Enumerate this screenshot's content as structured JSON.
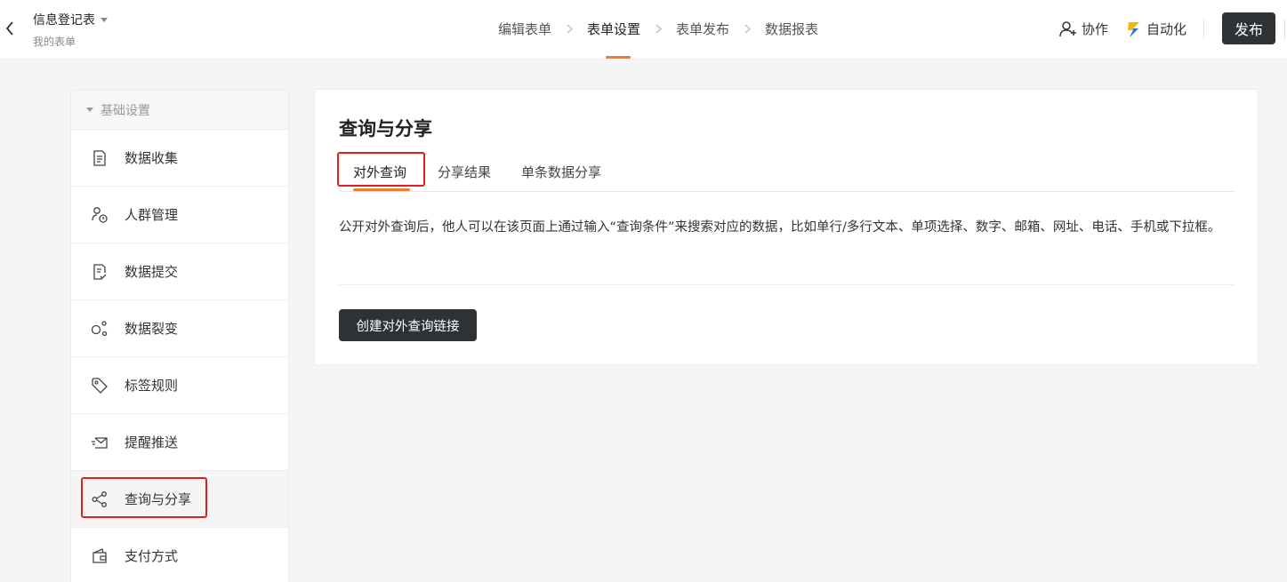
{
  "header": {
    "form_title": "信息登记表",
    "form_subtitle": "我的表单",
    "steps": [
      "编辑表单",
      "表单设置",
      "表单发布",
      "数据报表"
    ],
    "active_step": "表单设置",
    "collab_label": "协作",
    "automation_label": "自动化",
    "publish_label": "发布",
    "accent_color": "#f07d2c"
  },
  "sidebar": {
    "section_label": "基础设置",
    "items": [
      {
        "label": "数据收集",
        "icon": "document-list-icon"
      },
      {
        "label": "人群管理",
        "icon": "user-clock-icon"
      },
      {
        "label": "数据提交",
        "icon": "document-check-icon"
      },
      {
        "label": "数据裂变",
        "icon": "nodes-icon"
      },
      {
        "label": "标签规则",
        "icon": "tag-icon"
      },
      {
        "label": "提醒推送",
        "icon": "envelope-send-icon"
      },
      {
        "label": "查询与分享",
        "icon": "share-icon"
      },
      {
        "label": "支付方式",
        "icon": "wallet-icon"
      }
    ],
    "active_item": "查询与分享"
  },
  "main": {
    "title": "查询与分享",
    "tabs": [
      "对外查询",
      "分享结果",
      "单条数据分享"
    ],
    "active_tab": "对外查询",
    "description": "公开对外查询后，他人可以在该页面上通过输入“查询条件”来搜索对应的数据，比如单行/多行文本、单项选择、数字、邮箱、网址、电话、手机或下拉框。",
    "create_button_label": "创建对外查询链接"
  }
}
